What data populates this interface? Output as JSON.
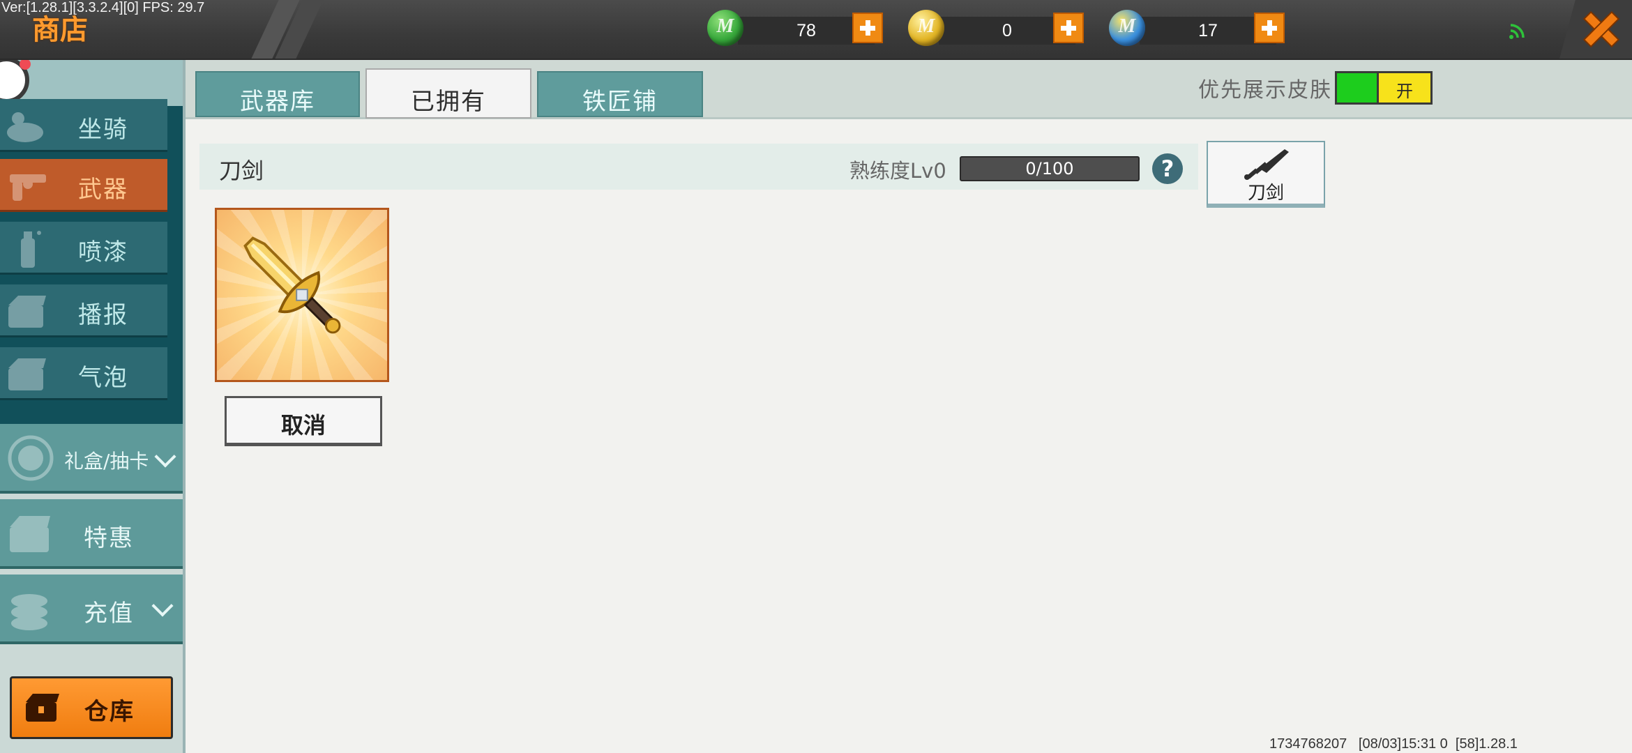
{
  "debug": {
    "version_text": "Ver:[1.28.1][3.3.2.4][0] FPS: 29.7"
  },
  "header": {
    "title": "商店"
  },
  "currencies": [
    {
      "name": "green-m-coin",
      "value": "78",
      "color": "#37a83b"
    },
    {
      "name": "gold-m-coin",
      "value": "0",
      "color": "#e2b526"
    },
    {
      "name": "blue-m-coin",
      "value": "17",
      "color": "#3c91de"
    }
  ],
  "sidebar": {
    "sub_items": [
      {
        "label": "坐骑",
        "icon": "mount-icon"
      },
      {
        "label": "武器",
        "icon": "revolver-icon",
        "active": true
      },
      {
        "label": "喷漆",
        "icon": "spray-can-icon"
      },
      {
        "label": "播报",
        "icon": "chest-icon"
      },
      {
        "label": "气泡",
        "icon": "chest-icon"
      }
    ],
    "gift_box_label": "礼盒/抽卡",
    "special_offer_label": "特惠",
    "recharge_label": "充值",
    "warehouse_label": "仓库"
  },
  "tabs": [
    {
      "label": "武器库"
    },
    {
      "label": "已拥有",
      "active": true
    },
    {
      "label": "铁匠铺"
    }
  ],
  "skin_pref": {
    "label": "优先展示皮肤",
    "toggle_label": "开",
    "on": true,
    "on_color": "#1dcd1d"
  },
  "category": {
    "name": "刀剑",
    "mastery_label": "熟练度Lv0",
    "progress_text": "0/100",
    "progress_fraction": 0.0,
    "help_glyph": "?",
    "filter_button_label": "刀剑"
  },
  "owned_items": [
    {
      "icon": "golden-sword-icon",
      "action_label": "取消"
    }
  ],
  "footer": {
    "text": "1734768207   [08/03]15:31 0  [58]1.28.1"
  }
}
